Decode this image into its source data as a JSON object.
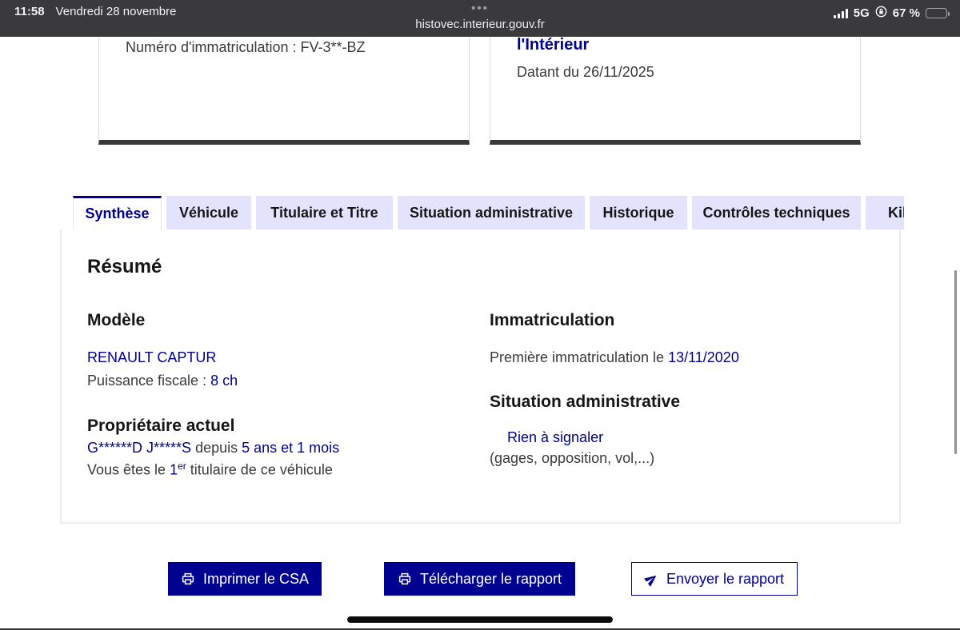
{
  "status_bar": {
    "time": "11:58",
    "date": "Vendredi 28 novembre",
    "menu_dots": "•••",
    "url": "histovec.interieur.gouv.fr",
    "network": "5G",
    "battery": "67 %"
  },
  "cards": {
    "registration_card": {
      "text": "Numéro d'immatriculation : FV-3**-BZ"
    },
    "certificate_card": {
      "title": "l'Intérieur",
      "date": "Datant du 26/11/2025"
    }
  },
  "tabs": [
    {
      "label": "Synthèse",
      "active": true
    },
    {
      "label": "Véhicule",
      "active": false
    },
    {
      "label": "Titulaire et Titre",
      "active": false
    },
    {
      "label": "Situation administrative",
      "active": false
    },
    {
      "label": "Historique",
      "active": false
    },
    {
      "label": "Contrôles techniques",
      "active": false
    },
    {
      "label": "Kil",
      "active": false
    }
  ],
  "summary": {
    "title": "Résumé",
    "model": {
      "heading": "Modèle",
      "name": "RENAULT CAPTUR",
      "power_label": "Puissance fiscale : ",
      "power_value": "8 ch"
    },
    "owner": {
      "heading": "Propriétaire actuel",
      "name": "G******D J*****S",
      "since_label": " depuis ",
      "duration": "5 ans et 1 mois",
      "holder_prefix": "Vous êtes le ",
      "holder_number": "1",
      "holder_ordinal": "er",
      "holder_suffix": " titulaire de ce véhicule"
    },
    "registration": {
      "heading": "Immatriculation",
      "label": "Première immatriculation le ",
      "date": "13/11/2020"
    },
    "admin_status": {
      "heading": "Situation administrative",
      "status": "Rien à signaler",
      "detail": "(gages, opposition, vol,...)"
    }
  },
  "actions": {
    "print": "Imprimer le CSA",
    "download": "Télécharger le rapport",
    "send": "Envoyer le rapport"
  },
  "colors": {
    "accent": "#000091",
    "tab_background": "#e3e3fd",
    "text_dark": "#161616",
    "text_gray": "#3a3a3a",
    "statusbar_background": "#3a3a3c"
  }
}
